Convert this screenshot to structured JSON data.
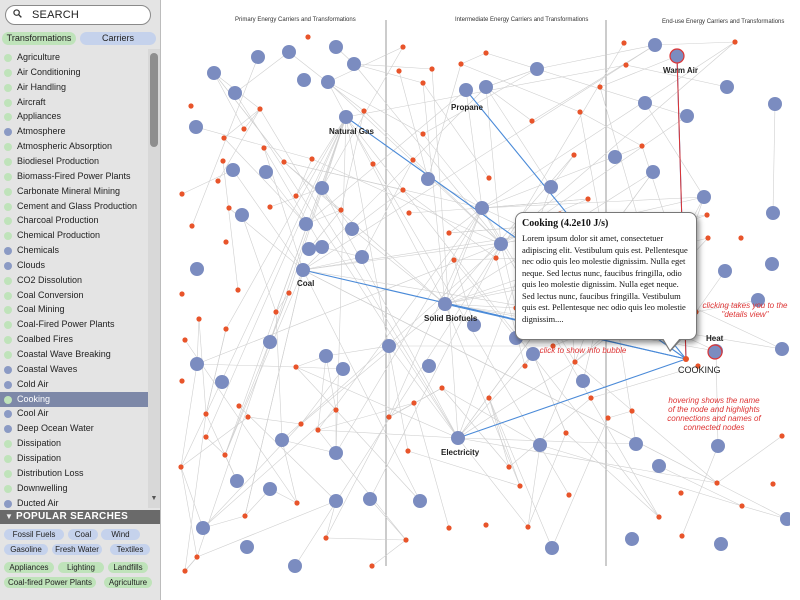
{
  "search": {
    "label": "SEARCH"
  },
  "tabs": [
    {
      "label": "Transformations",
      "color": "#bfe3ba"
    },
    {
      "label": "Carriers",
      "color": "#c5d2ec"
    }
  ],
  "colors": {
    "transformation_dot": "#bfe3ba",
    "carrier_dot": "#8b9ac4",
    "selected_row": "#7d88a8",
    "node_large": "#7b8cc0",
    "node_small": "#e8542a",
    "annotation": "#dd3333",
    "highlight_edge": "#4a8ad8"
  },
  "sidebar": {
    "items": [
      {
        "label": "Agriculture",
        "kind": "transformation"
      },
      {
        "label": "Air Conditioning",
        "kind": "transformation"
      },
      {
        "label": "Air Handling",
        "kind": "transformation"
      },
      {
        "label": "Aircraft",
        "kind": "transformation"
      },
      {
        "label": "Appliances",
        "kind": "transformation"
      },
      {
        "label": "Atmosphere",
        "kind": "carrier"
      },
      {
        "label": "Atmospheric Absorption",
        "kind": "transformation"
      },
      {
        "label": "Biodiesel Production",
        "kind": "transformation"
      },
      {
        "label": "Biomass-Fired Power Plants",
        "kind": "transformation"
      },
      {
        "label": "Carbonate Mineral Mining",
        "kind": "transformation"
      },
      {
        "label": "Cement and Glass Production",
        "kind": "transformation"
      },
      {
        "label": "Charcoal Production",
        "kind": "transformation"
      },
      {
        "label": "Chemical Production",
        "kind": "transformation"
      },
      {
        "label": "Chemicals",
        "kind": "carrier"
      },
      {
        "label": "Clouds",
        "kind": "carrier"
      },
      {
        "label": "CO2 Dissolution",
        "kind": "transformation"
      },
      {
        "label": "Coal Conversion",
        "kind": "transformation"
      },
      {
        "label": "Coal Mining",
        "kind": "transformation"
      },
      {
        "label": "Coal-Fired Power Plants",
        "kind": "transformation"
      },
      {
        "label": "Coalbed Fires",
        "kind": "transformation"
      },
      {
        "label": "Coastal Wave Breaking",
        "kind": "transformation"
      },
      {
        "label": "Coastal Waves",
        "kind": "carrier"
      },
      {
        "label": "Cold Air",
        "kind": "carrier"
      },
      {
        "label": "Cooking",
        "kind": "transformation",
        "selected": true
      },
      {
        "label": "Cool Air",
        "kind": "carrier"
      },
      {
        "label": "Deep Ocean Water",
        "kind": "carrier"
      },
      {
        "label": "Dissipation",
        "kind": "transformation"
      },
      {
        "label": "Dissipation",
        "kind": "transformation"
      },
      {
        "label": "Distribution Loss",
        "kind": "transformation"
      },
      {
        "label": "Downwelling",
        "kind": "transformation"
      },
      {
        "label": "Ducted Air",
        "kind": "carrier"
      }
    ]
  },
  "popular": {
    "title": "POPULAR SEARCHES",
    "tags": [
      {
        "label": "Fossil Fuels",
        "kind": "carrier"
      },
      {
        "label": "Coal",
        "kind": "carrier"
      },
      {
        "label": "Wind",
        "kind": "carrier"
      },
      {
        "label": "Gasoline",
        "kind": "carrier"
      },
      {
        "label": "Fresh Water",
        "kind": "carrier"
      },
      {
        "label": "Textiles",
        "kind": "carrier"
      },
      {
        "label": "Appliances",
        "kind": "transformation"
      },
      {
        "label": "Lighting",
        "kind": "transformation"
      },
      {
        "label": "Landfills",
        "kind": "transformation"
      },
      {
        "label": "Coal-fired Power Plants",
        "kind": "transformation"
      },
      {
        "label": "Agriculture",
        "kind": "transformation"
      }
    ]
  },
  "columns": [
    {
      "caption": "Primary Energy Carriers and Transformations"
    },
    {
      "caption": "Intermediate Energy Carriers and Transformations"
    },
    {
      "caption": "End-use Energy Carriers and Transformations"
    }
  ],
  "graph": {
    "labeled_nodes": [
      "Natural Gas",
      "Propane",
      "Warm Air",
      "Coal",
      "Solid Biofuels",
      "Electricity",
      "Heat",
      "COOKING"
    ],
    "focus_node": "COOKING"
  },
  "bubble": {
    "title": "Cooking  (4.2e10 J/s)",
    "body": "Lorem ipsum dolor sit amet, consectetuer adipiscing elit. Vestibulum quis est. Pellentesque nec odio quis leo molestie dignissim. Nulla eget neque. Sed lectus nunc, faucibus fringilla, odio quis leo molestie dignissim. Nulla eget neque. Sed lectus nunc, faucibus fringilla. Vestibulum quis est. Pellentesque nec odio quis leo molestie dignissim...."
  },
  "annotations": [
    {
      "text": "click to show info bubble"
    },
    {
      "text": "clicking takes you to the \"details view\""
    },
    {
      "text": "hovering shows the name of the node and highlights connections and names of connected nodes"
    }
  ]
}
